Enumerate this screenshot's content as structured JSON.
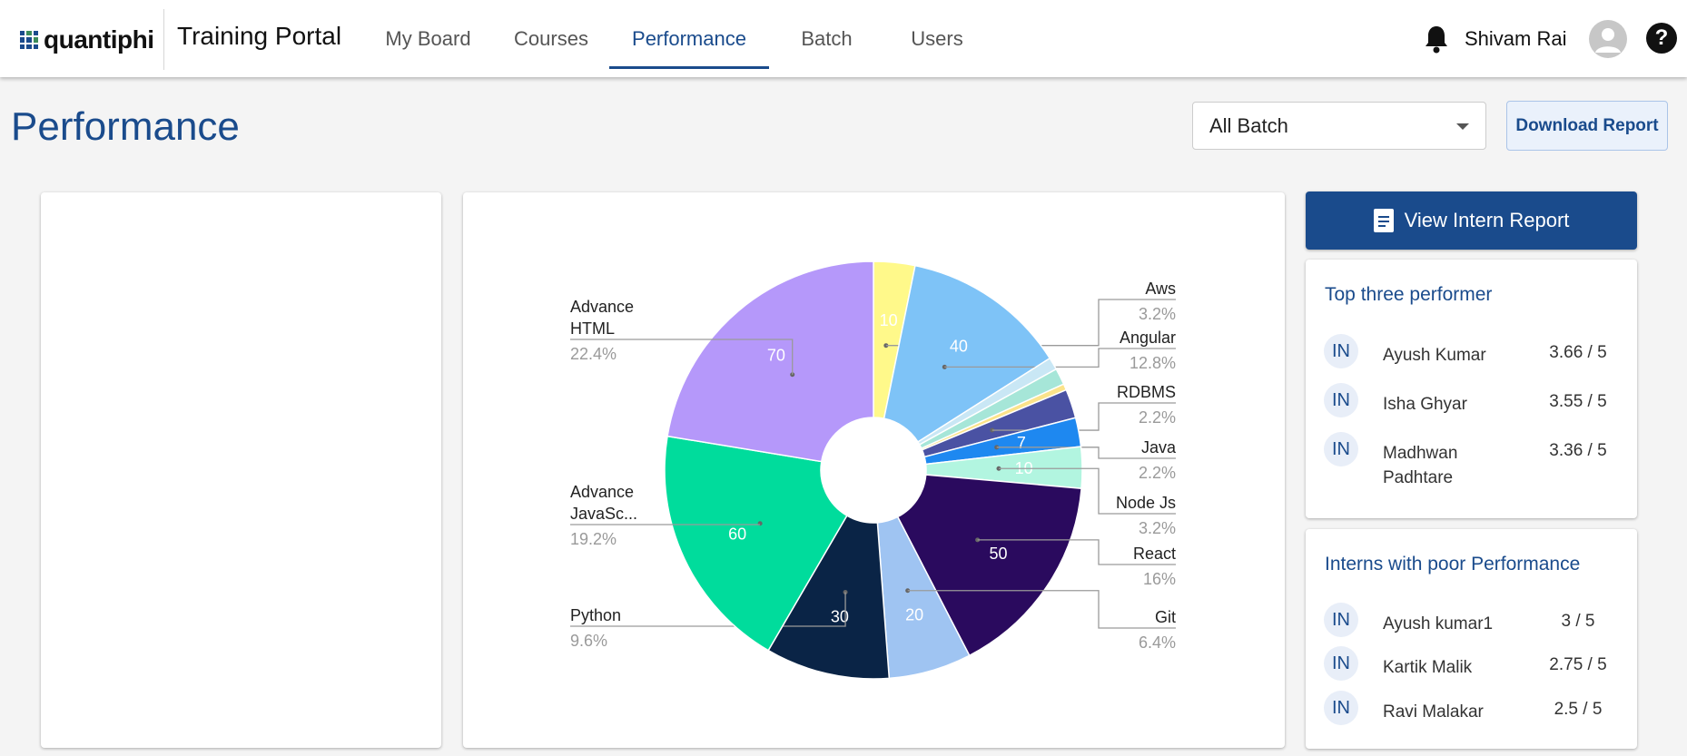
{
  "app": {
    "logo_text": "quantiphi",
    "title": "Training Portal",
    "nav": [
      {
        "label": "My Board",
        "active": false
      },
      {
        "label": "Courses",
        "active": false
      },
      {
        "label": "Performance",
        "active": true
      },
      {
        "label": "Batch",
        "active": false
      },
      {
        "label": "Users",
        "active": false
      }
    ],
    "user_name": "Shivam Rai",
    "help_glyph": "?"
  },
  "page": {
    "title": "Performance",
    "batch_select_value": "All Batch",
    "download_label": "Download Report",
    "view_report_label": "View Intern Report"
  },
  "top_performers": {
    "title": "Top three performer",
    "rows": [
      {
        "badge": "IN",
        "name": "Ayush Kumar",
        "score": "3.66 / 5"
      },
      {
        "badge": "IN",
        "name": "Isha Ghyar",
        "score": "3.55 / 5"
      },
      {
        "badge": "IN",
        "name": "Madhwan Padhtare",
        "score": "3.36 / 5"
      }
    ]
  },
  "poor_performers": {
    "title": "Interns with poor Performance",
    "rows": [
      {
        "badge": "IN",
        "name": "Ayush kumar1",
        "score": "3 / 5"
      },
      {
        "badge": "IN",
        "name": "Kartik Malik",
        "score": "2.75 / 5"
      },
      {
        "badge": "IN",
        "name": "Ravi Malakar",
        "score": "2.5 / 5"
      }
    ]
  },
  "colors": {
    "brand": "#1a4b8c",
    "background": "#f4f4f4"
  },
  "chart_data": {
    "type": "pie",
    "donut": true,
    "slices": [
      {
        "label": "Aws",
        "value": 10,
        "percent": "3.2%",
        "color": "#fff98a",
        "show_value": true,
        "show_label": true
      },
      {
        "label": "Angular",
        "value": 40,
        "percent": "12.8%",
        "color": "#7ec3f7",
        "show_value": true,
        "show_label": true
      },
      {
        "label": "",
        "value": 3,
        "percent": "",
        "color": "#c9e7f5",
        "show_value": false,
        "show_label": false
      },
      {
        "label": "",
        "value": 4,
        "percent": "",
        "color": "#a6e6d8",
        "show_value": false,
        "show_label": false
      },
      {
        "label": "",
        "value": 1.5,
        "percent": "",
        "color": "#fbe38a",
        "show_value": false,
        "show_label": false
      },
      {
        "label": "RDBMS",
        "value": 7,
        "percent": "2.2%",
        "color": "#4a52a3",
        "show_value": false,
        "show_label": true
      },
      {
        "label": "Java",
        "value": 7,
        "percent": "2.2%",
        "color": "#1e88f0",
        "show_value": true,
        "show_label": true
      },
      {
        "label": "Node Js",
        "value": 10,
        "percent": "3.2%",
        "color": "#b2f5e0",
        "show_value": true,
        "show_label": true
      },
      {
        "label": "React",
        "value": 50,
        "percent": "16%",
        "color": "#2a0a5e",
        "show_value": true,
        "show_label": true
      },
      {
        "label": "Git",
        "value": 20,
        "percent": "6.4%",
        "color": "#9fc4f2",
        "show_value": true,
        "show_label": true
      },
      {
        "label": "Python",
        "value": 30,
        "percent": "9.6%",
        "color": "#0a2446",
        "show_value": true,
        "show_label": true
      },
      {
        "label": "Advance JavaSc...",
        "value": 60,
        "percent": "19.2%",
        "color": "#00dc9c",
        "show_value": true,
        "show_label": true
      },
      {
        "label": "Advance HTML",
        "value": 70,
        "percent": "22.4%",
        "color": "#b598fa",
        "show_value": true,
        "show_label": true
      }
    ]
  }
}
